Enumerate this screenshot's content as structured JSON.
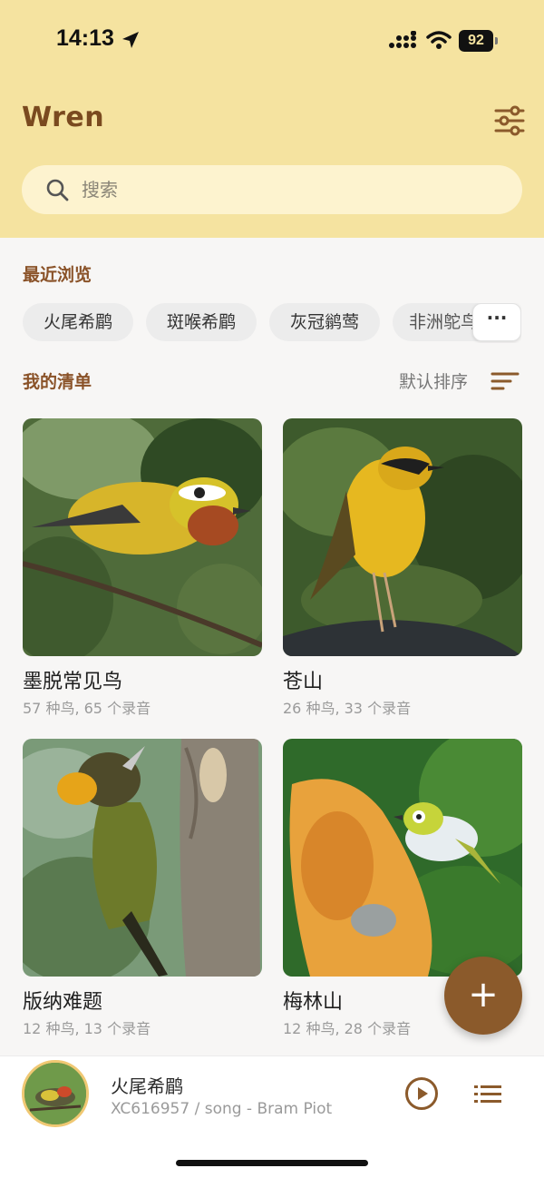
{
  "status_bar": {
    "time": "14:13",
    "battery": "92"
  },
  "header": {
    "app_title": "Wren",
    "search_placeholder": "搜索"
  },
  "recent": {
    "title": "最近浏览",
    "items": [
      "火尾希鹛",
      "斑喉希鹛",
      "灰冠鹟莺",
      "非洲鸵鸟"
    ],
    "more_label": "···"
  },
  "lists": {
    "title": "我的清单",
    "sort_label": "默认排序",
    "cards": [
      {
        "name": "墨脱常见鸟",
        "meta": "57 种鸟, 65 个录音"
      },
      {
        "name": "苍山",
        "meta": "26 种鸟, 33 个录音"
      },
      {
        "name": "版纳难题",
        "meta": "12 种鸟, 13 个录音"
      },
      {
        "name": "梅林山",
        "meta": "12 种鸟, 28 个录音"
      }
    ]
  },
  "fab": {
    "label": "+"
  },
  "player": {
    "title": "火尾希鹛",
    "subtitle": "XC616957 / song - Bram Piot"
  },
  "colors": {
    "header_bg": "#f5e3a0",
    "accent": "#8b5a2b",
    "search_bg": "#fdf3cf"
  }
}
